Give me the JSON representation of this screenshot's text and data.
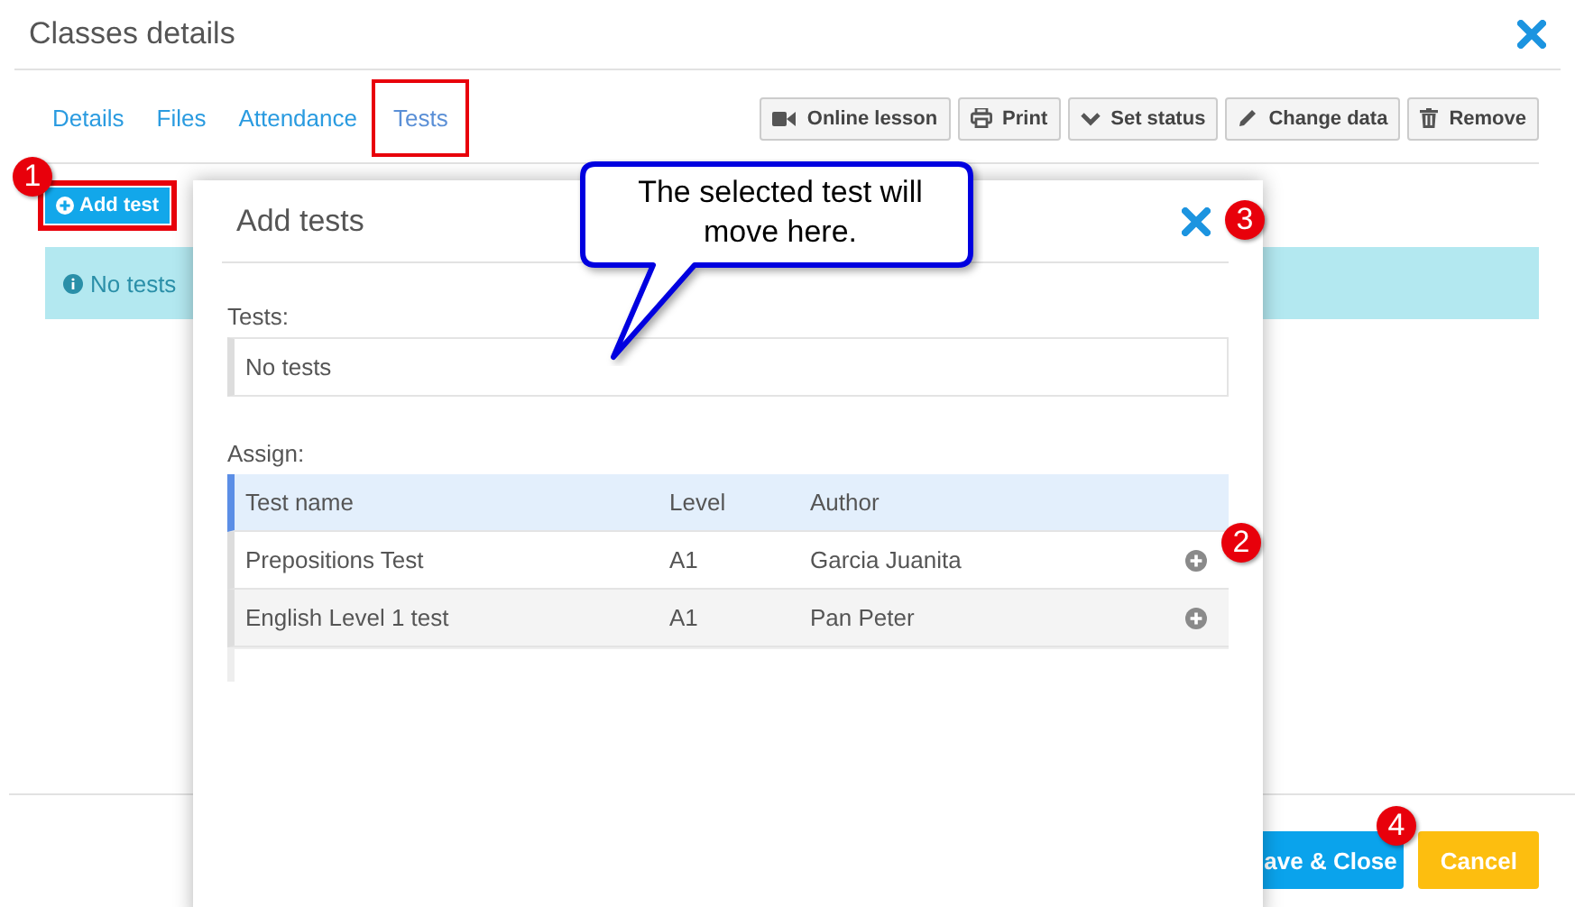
{
  "window": {
    "title": "Classes details"
  },
  "tabs": [
    {
      "label": "Details",
      "selected": false
    },
    {
      "label": "Files",
      "selected": false
    },
    {
      "label": "Attendance",
      "selected": false
    },
    {
      "label": "Tests",
      "selected": true
    }
  ],
  "toolbar": [
    {
      "kind": "video",
      "label": "Online lesson"
    },
    {
      "kind": "print",
      "label": "Print"
    },
    {
      "kind": "check",
      "label": "Set status"
    },
    {
      "kind": "pencil",
      "label": "Change data"
    },
    {
      "kind": "trash",
      "label": "Remove"
    }
  ],
  "add_button": {
    "label": "Add test"
  },
  "alert": {
    "text": "No tests"
  },
  "footer_buttons": [
    {
      "kind": "primary",
      "label": "ave & Close"
    },
    {
      "kind": "warning",
      "label": "Cancel"
    }
  ],
  "modal": {
    "title": "Add tests",
    "tests_label": "Tests:",
    "tests_value": "No tests",
    "assign_label": "Assign:",
    "table": {
      "columns": [
        "Test name",
        "Level",
        "Author"
      ],
      "rows": [
        {
          "cells": [
            "Prepositions Test",
            "A1",
            "Garcia Juanita"
          ]
        },
        {
          "cells": [
            "English Level 1 test",
            "A1",
            "Pan Peter"
          ]
        }
      ]
    }
  },
  "annotations": {
    "callout": "The selected test will move here.",
    "badges": [
      "1",
      "2",
      "3",
      "4"
    ]
  }
}
